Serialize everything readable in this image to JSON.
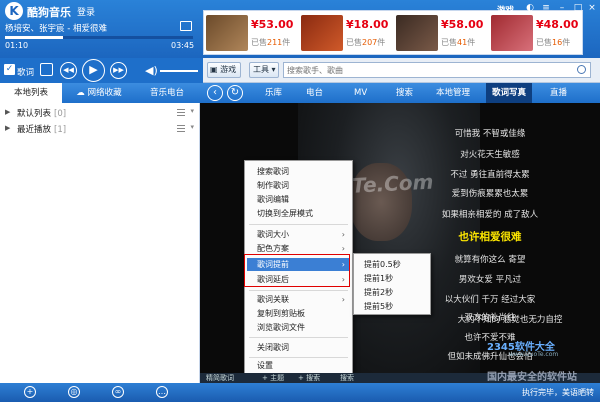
{
  "app": {
    "title": "酷狗音乐",
    "login": "登录"
  },
  "player": {
    "song": "杨培安、张宇宸 - 相爱很难",
    "time_current": "01:10",
    "time_total": "03:45",
    "progress": 0.31,
    "lyric_toggle_label": "歌词"
  },
  "ads": [
    {
      "price": "¥53.00",
      "sold_prefix": "已售",
      "sold_count": "211",
      "sold_suffix": "件"
    },
    {
      "price": "¥18.00",
      "sold_prefix": "已售",
      "sold_count": "207",
      "sold_suffix": "件"
    },
    {
      "price": "¥58.00",
      "sold_prefix": "已售",
      "sold_count": "41",
      "sold_suffix": "件"
    },
    {
      "price": "¥48.00",
      "sold_prefix": "已售",
      "sold_count": "16",
      "sold_suffix": "件"
    }
  ],
  "top_right": {
    "game": "游戏"
  },
  "toolbar": {
    "game_btn": "游戏",
    "tools_btn": "工具",
    "search_placeholder": "搜索歌手、歌曲"
  },
  "left_tabs": [
    "本地列表",
    "网络收藏",
    "音乐电台"
  ],
  "nav": [
    "乐库",
    "电台",
    "MV",
    "搜索",
    "本地管理",
    "歌词写真",
    "直播"
  ],
  "playlists": [
    {
      "name": "默认列表",
      "count": "[0]"
    },
    {
      "name": "最近播放",
      "count": "[1]"
    }
  ],
  "lyrics": [
    "可惜我 不智或佳缘",
    "对火花天生敏感",
    "不过 勇往直前得太累",
    "爱到伤痕累累也太累",
    "如果相亲相爱的 成了敌人",
    "也许相爱很难",
    "就算有你这么 寄望",
    "男欢女爱 平凡过",
    "以大伙们 千万 经过大家",
    "双方的礼尚往",
    "大约不知的 感觉也无力自控",
    "也许不爱不难",
    "但如未成佛升仙也会怕"
  ],
  "active_lyric_index": 5,
  "watermark": "QiqoTe.Com",
  "context_menu": {
    "items": [
      {
        "label": "搜索歌词",
        "sub": false
      },
      {
        "label": "制作歌词",
        "sub": false
      },
      {
        "label": "歌词编辑",
        "sub": false
      },
      {
        "label": "切换到全屏模式",
        "sub": false
      },
      {
        "label": "歌词大小",
        "sub": true
      },
      {
        "label": "配色方案",
        "sub": true
      },
      {
        "label": "歌词提前",
        "sub": true
      },
      {
        "label": "歌词延后",
        "sub": true
      },
      {
        "label": "歌词关联",
        "sub": true
      },
      {
        "label": "复制到剪贴板",
        "sub": false
      },
      {
        "label": "浏览歌词文件",
        "sub": false
      },
      {
        "label": "关闭歌词",
        "sub": false
      },
      {
        "label": "设置",
        "sub": false
      }
    ],
    "highlighted_index": 6
  },
  "submenu": [
    "提前0.5秒",
    "提前1秒",
    "提前2秒",
    "提前5秒"
  ],
  "lyric_bar": [
    "精简歌词",
    "+ 主题",
    "+ 搜索",
    "搜索"
  ],
  "status": {
    "text": "执行完毕，美语晒转"
  },
  "watermarks": {
    "logo": "2345软件大全",
    "logo_sub": "www.DuoTe.com",
    "security": "国内最安全的软件站"
  }
}
